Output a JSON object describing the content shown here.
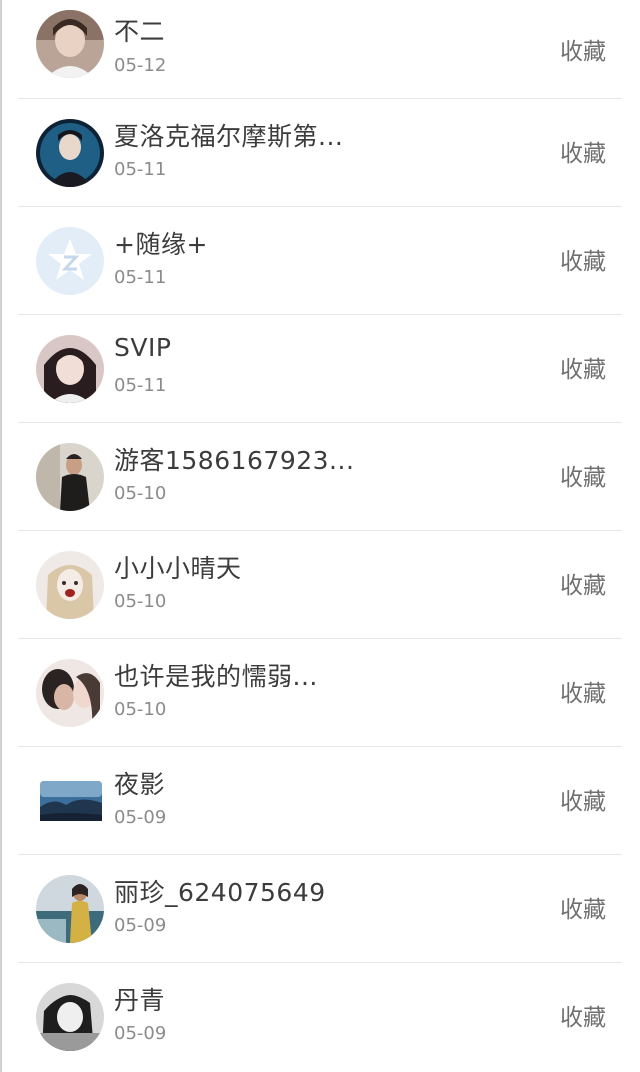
{
  "users": [
    {
      "name": "不二",
      "date": "05-12",
      "action": "收藏",
      "avatar": "boy-portrait-avatar"
    },
    {
      "name": "夏洛克福尔摩斯第...",
      "date": "05-11",
      "action": "收藏",
      "avatar": "anime-detective-avatar"
    },
    {
      "name": "+随缘+",
      "date": "05-11",
      "action": "收藏",
      "avatar": "default-qq-star-avatar"
    },
    {
      "name": "SVIP",
      "date": "05-11",
      "action": "收藏",
      "avatar": "girl-portrait-avatar"
    },
    {
      "name": "游客1586167923...",
      "date": "05-10",
      "action": "收藏",
      "avatar": "man-photo-avatar"
    },
    {
      "name": "小小小晴天",
      "date": "05-10",
      "action": "收藏",
      "avatar": "pale-girl-avatar"
    },
    {
      "name": "也许是我的懦弱...",
      "date": "05-10",
      "action": "收藏",
      "avatar": "couple-kiss-avatar"
    },
    {
      "name": "夜影",
      "date": "05-09",
      "action": "收藏",
      "avatar": "landscape-avatar"
    },
    {
      "name": "丽珍_624075649",
      "date": "05-09",
      "action": "收藏",
      "avatar": "woman-outdoor-avatar"
    },
    {
      "name": "丹青",
      "date": "05-09",
      "action": "收藏",
      "avatar": "bw-girl-avatar"
    }
  ]
}
